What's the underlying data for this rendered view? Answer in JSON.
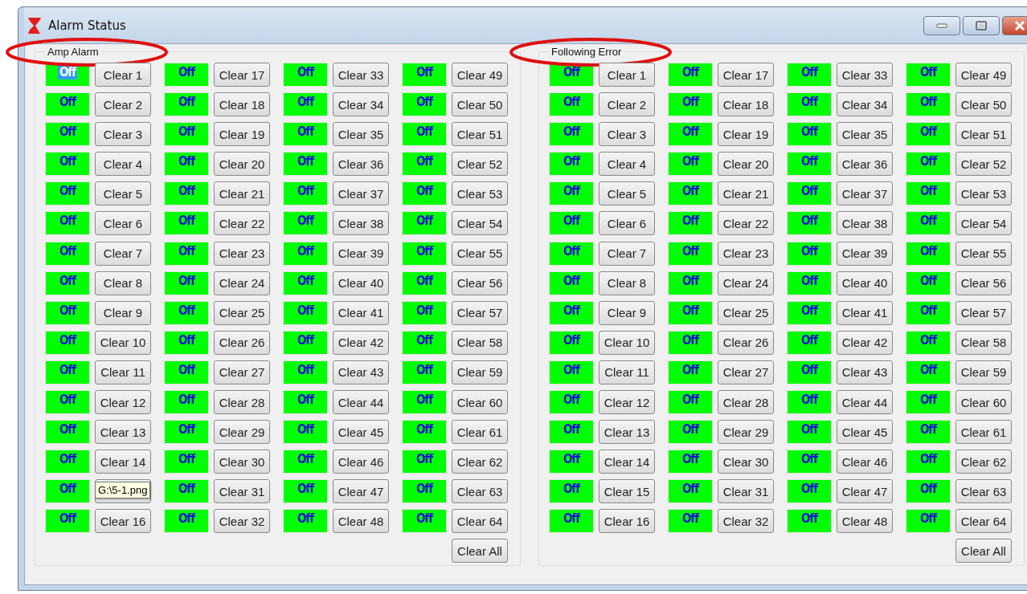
{
  "window": {
    "title": "Alarm Status"
  },
  "groups": [
    {
      "title": "Amp Alarm",
      "annotated": true,
      "clear_all": "Clear All",
      "channels": [
        {
          "state": "Off",
          "selected": true,
          "button": "Clear 1"
        },
        {
          "state": "Off",
          "selected": false,
          "button": "Clear 2"
        },
        {
          "state": "Off",
          "selected": false,
          "button": "Clear 3"
        },
        {
          "state": "Off",
          "selected": false,
          "button": "Clear 4"
        },
        {
          "state": "Off",
          "selected": false,
          "button": "Clear 5"
        },
        {
          "state": "Off",
          "selected": false,
          "button": "Clear 6"
        },
        {
          "state": "Off",
          "selected": false,
          "button": "Clear 7"
        },
        {
          "state": "Off",
          "selected": false,
          "button": "Clear 8"
        },
        {
          "state": "Off",
          "selected": false,
          "button": "Clear 9"
        },
        {
          "state": "Off",
          "selected": false,
          "button": "Clear 10"
        },
        {
          "state": "Off",
          "selected": false,
          "button": "Clear 11"
        },
        {
          "state": "Off",
          "selected": false,
          "button": "Clear 12"
        },
        {
          "state": "Off",
          "selected": false,
          "button": "Clear 13"
        },
        {
          "state": "Off",
          "selected": false,
          "button": "Clear 14"
        },
        {
          "state": "Off",
          "selected": false,
          "tooltip": "G:\\5-1.png"
        },
        {
          "state": "Off",
          "selected": false,
          "button": "Clear 16"
        },
        {
          "state": "Off",
          "selected": false,
          "button": "Clear 17"
        },
        {
          "state": "Off",
          "selected": false,
          "button": "Clear 18"
        },
        {
          "state": "Off",
          "selected": false,
          "button": "Clear 19"
        },
        {
          "state": "Off",
          "selected": false,
          "button": "Clear 20"
        },
        {
          "state": "Off",
          "selected": false,
          "button": "Clear 21"
        },
        {
          "state": "Off",
          "selected": false,
          "button": "Clear 22"
        },
        {
          "state": "Off",
          "selected": false,
          "button": "Clear 23"
        },
        {
          "state": "Off",
          "selected": false,
          "button": "Clear 24"
        },
        {
          "state": "Off",
          "selected": false,
          "button": "Clear 25"
        },
        {
          "state": "Off",
          "selected": false,
          "button": "Clear 26"
        },
        {
          "state": "Off",
          "selected": false,
          "button": "Clear 27"
        },
        {
          "state": "Off",
          "selected": false,
          "button": "Clear 28"
        },
        {
          "state": "Off",
          "selected": false,
          "button": "Clear 29"
        },
        {
          "state": "Off",
          "selected": false,
          "button": "Clear 30"
        },
        {
          "state": "Off",
          "selected": false,
          "button": "Clear 31"
        },
        {
          "state": "Off",
          "selected": false,
          "button": "Clear 32"
        },
        {
          "state": "Off",
          "selected": false,
          "button": "Clear 33"
        },
        {
          "state": "Off",
          "selected": false,
          "button": "Clear 34"
        },
        {
          "state": "Off",
          "selected": false,
          "button": "Clear 35"
        },
        {
          "state": "Off",
          "selected": false,
          "button": "Clear 36"
        },
        {
          "state": "Off",
          "selected": false,
          "button": "Clear 37"
        },
        {
          "state": "Off",
          "selected": false,
          "button": "Clear 38"
        },
        {
          "state": "Off",
          "selected": false,
          "button": "Clear 39"
        },
        {
          "state": "Off",
          "selected": false,
          "button": "Clear 40"
        },
        {
          "state": "Off",
          "selected": false,
          "button": "Clear 41"
        },
        {
          "state": "Off",
          "selected": false,
          "button": "Clear 42"
        },
        {
          "state": "Off",
          "selected": false,
          "button": "Clear 43"
        },
        {
          "state": "Off",
          "selected": false,
          "button": "Clear 44"
        },
        {
          "state": "Off",
          "selected": false,
          "button": "Clear 45"
        },
        {
          "state": "Off",
          "selected": false,
          "button": "Clear 46"
        },
        {
          "state": "Off",
          "selected": false,
          "button": "Clear 47"
        },
        {
          "state": "Off",
          "selected": false,
          "button": "Clear 48"
        },
        {
          "state": "Off",
          "selected": false,
          "button": "Clear 49"
        },
        {
          "state": "Off",
          "selected": false,
          "button": "Clear 50"
        },
        {
          "state": "Off",
          "selected": false,
          "button": "Clear 51"
        },
        {
          "state": "Off",
          "selected": false,
          "button": "Clear 52"
        },
        {
          "state": "Off",
          "selected": false,
          "button": "Clear 53"
        },
        {
          "state": "Off",
          "selected": false,
          "button": "Clear 54"
        },
        {
          "state": "Off",
          "selected": false,
          "button": "Clear 55"
        },
        {
          "state": "Off",
          "selected": false,
          "button": "Clear 56"
        },
        {
          "state": "Off",
          "selected": false,
          "button": "Clear 57"
        },
        {
          "state": "Off",
          "selected": false,
          "button": "Clear 58"
        },
        {
          "state": "Off",
          "selected": false,
          "button": "Clear 59"
        },
        {
          "state": "Off",
          "selected": false,
          "button": "Clear 60"
        },
        {
          "state": "Off",
          "selected": false,
          "button": "Clear 61"
        },
        {
          "state": "Off",
          "selected": false,
          "button": "Clear 62"
        },
        {
          "state": "Off",
          "selected": false,
          "button": "Clear 63"
        },
        {
          "state": "Off",
          "selected": false,
          "button": "Clear 64"
        }
      ]
    },
    {
      "title": "Following Error",
      "annotated": true,
      "clear_all": "Clear All",
      "channels": [
        {
          "state": "Off",
          "selected": false,
          "button": "Clear 1"
        },
        {
          "state": "Off",
          "selected": false,
          "button": "Clear 2"
        },
        {
          "state": "Off",
          "selected": false,
          "button": "Clear 3"
        },
        {
          "state": "Off",
          "selected": false,
          "button": "Clear 4"
        },
        {
          "state": "Off",
          "selected": false,
          "button": "Clear 5"
        },
        {
          "state": "Off",
          "selected": false,
          "button": "Clear 6"
        },
        {
          "state": "Off",
          "selected": false,
          "button": "Clear 7"
        },
        {
          "state": "Off",
          "selected": false,
          "button": "Clear 8"
        },
        {
          "state": "Off",
          "selected": false,
          "button": "Clear 9"
        },
        {
          "state": "Off",
          "selected": false,
          "button": "Clear 10"
        },
        {
          "state": "Off",
          "selected": false,
          "button": "Clear 11"
        },
        {
          "state": "Off",
          "selected": false,
          "button": "Clear 12"
        },
        {
          "state": "Off",
          "selected": false,
          "button": "Clear 13"
        },
        {
          "state": "Off",
          "selected": false,
          "button": "Clear 14"
        },
        {
          "state": "Off",
          "selected": false,
          "button": "Clear 15"
        },
        {
          "state": "Off",
          "selected": false,
          "button": "Clear 16"
        },
        {
          "state": "Off",
          "selected": false,
          "button": "Clear 17"
        },
        {
          "state": "Off",
          "selected": false,
          "button": "Clear 18"
        },
        {
          "state": "Off",
          "selected": false,
          "button": "Clear 19"
        },
        {
          "state": "Off",
          "selected": false,
          "button": "Clear 20"
        },
        {
          "state": "Off",
          "selected": false,
          "button": "Clear 21"
        },
        {
          "state": "Off",
          "selected": false,
          "button": "Clear 22"
        },
        {
          "state": "Off",
          "selected": false,
          "button": "Clear 23"
        },
        {
          "state": "Off",
          "selected": false,
          "button": "Clear 24"
        },
        {
          "state": "Off",
          "selected": false,
          "button": "Clear 25"
        },
        {
          "state": "Off",
          "selected": false,
          "button": "Clear 26"
        },
        {
          "state": "Off",
          "selected": false,
          "button": "Clear 27"
        },
        {
          "state": "Off",
          "selected": false,
          "button": "Clear 28"
        },
        {
          "state": "Off",
          "selected": false,
          "button": "Clear 29"
        },
        {
          "state": "Off",
          "selected": false,
          "button": "Clear 30"
        },
        {
          "state": "Off",
          "selected": false,
          "button": "Clear 31"
        },
        {
          "state": "Off",
          "selected": false,
          "button": "Clear 32"
        },
        {
          "state": "Off",
          "selected": false,
          "button": "Clear 33"
        },
        {
          "state": "Off",
          "selected": false,
          "button": "Clear 34"
        },
        {
          "state": "Off",
          "selected": false,
          "button": "Clear 35"
        },
        {
          "state": "Off",
          "selected": false,
          "button": "Clear 36"
        },
        {
          "state": "Off",
          "selected": false,
          "button": "Clear 37"
        },
        {
          "state": "Off",
          "selected": false,
          "button": "Clear 38"
        },
        {
          "state": "Off",
          "selected": false,
          "button": "Clear 39"
        },
        {
          "state": "Off",
          "selected": false,
          "button": "Clear 40"
        },
        {
          "state": "Off",
          "selected": false,
          "button": "Clear 41"
        },
        {
          "state": "Off",
          "selected": false,
          "button": "Clear 42"
        },
        {
          "state": "Off",
          "selected": false,
          "button": "Clear 43"
        },
        {
          "state": "Off",
          "selected": false,
          "button": "Clear 44"
        },
        {
          "state": "Off",
          "selected": false,
          "button": "Clear 45"
        },
        {
          "state": "Off",
          "selected": false,
          "button": "Clear 46"
        },
        {
          "state": "Off",
          "selected": false,
          "button": "Clear 47"
        },
        {
          "state": "Off",
          "selected": false,
          "button": "Clear 48"
        },
        {
          "state": "Off",
          "selected": false,
          "button": "Clear 49"
        },
        {
          "state": "Off",
          "selected": false,
          "button": "Clear 50"
        },
        {
          "state": "Off",
          "selected": false,
          "button": "Clear 51"
        },
        {
          "state": "Off",
          "selected": false,
          "button": "Clear 52"
        },
        {
          "state": "Off",
          "selected": false,
          "button": "Clear 53"
        },
        {
          "state": "Off",
          "selected": false,
          "button": "Clear 54"
        },
        {
          "state": "Off",
          "selected": false,
          "button": "Clear 55"
        },
        {
          "state": "Off",
          "selected": false,
          "button": "Clear 56"
        },
        {
          "state": "Off",
          "selected": false,
          "button": "Clear 57"
        },
        {
          "state": "Off",
          "selected": false,
          "button": "Clear 58"
        },
        {
          "state": "Off",
          "selected": false,
          "button": "Clear 59"
        },
        {
          "state": "Off",
          "selected": false,
          "button": "Clear 60"
        },
        {
          "state": "Off",
          "selected": false,
          "button": "Clear 61"
        },
        {
          "state": "Off",
          "selected": false,
          "button": "Clear 62"
        },
        {
          "state": "Off",
          "selected": false,
          "button": "Clear 63"
        },
        {
          "state": "Off",
          "selected": false,
          "button": "Clear 64"
        }
      ]
    }
  ]
}
